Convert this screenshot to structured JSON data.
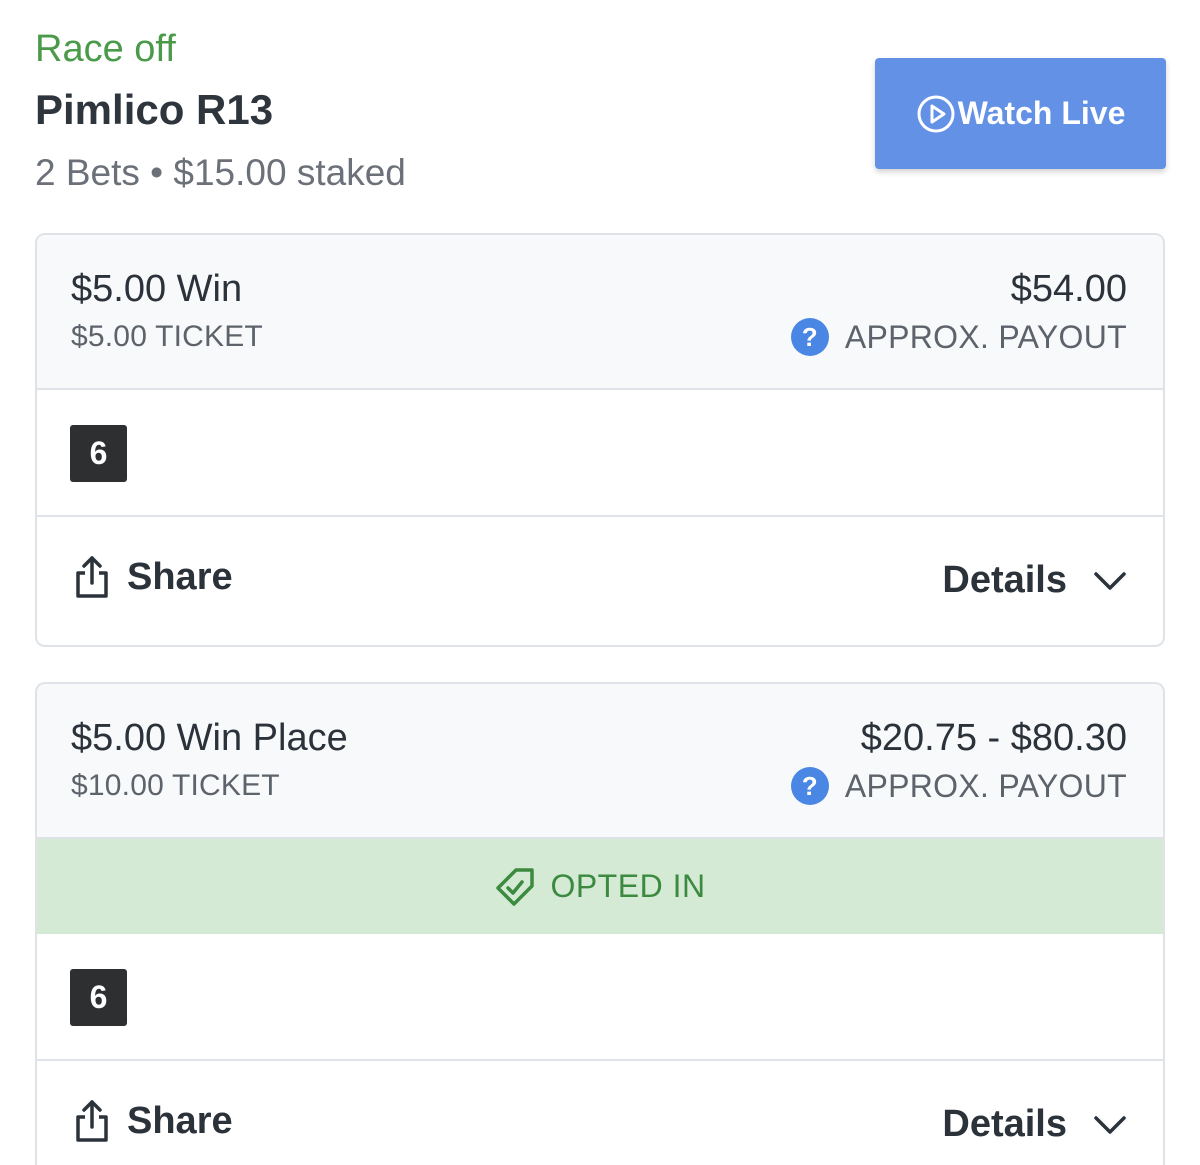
{
  "header": {
    "status": "Race off",
    "race_name": "Pimlico R13",
    "summary": "2 Bets • $15.00 staked",
    "watch_label": "Watch Live"
  },
  "colors": {
    "status_green": "#4a9a4a",
    "watch_button": "#6391e6",
    "help_icon": "#4a86e3",
    "opted_in_bg": "#d4ead4",
    "opted_in_text": "#3c8a40",
    "runner_badge": "#2e2f31"
  },
  "bets": [
    {
      "bet_type": "$5.00 Win",
      "ticket": "$5.00 TICKET",
      "payout": "$54.00",
      "payout_label": "APPROX. PAYOUT",
      "runner": "6",
      "share_label": "Share",
      "details_label": "Details"
    },
    {
      "bet_type": "$5.00 Win Place",
      "ticket": "$10.00 TICKET",
      "payout": "$20.75 - $80.30",
      "payout_label": "APPROX. PAYOUT",
      "opted_in_label": "OPTED IN",
      "runner": "6",
      "share_label": "Share",
      "details_label": "Details"
    }
  ],
  "icons": {
    "watch": "play-circle-icon",
    "help": "question-icon",
    "share": "share-icon",
    "details": "chevron-down-icon",
    "opted_in": "tag-check-icon"
  }
}
